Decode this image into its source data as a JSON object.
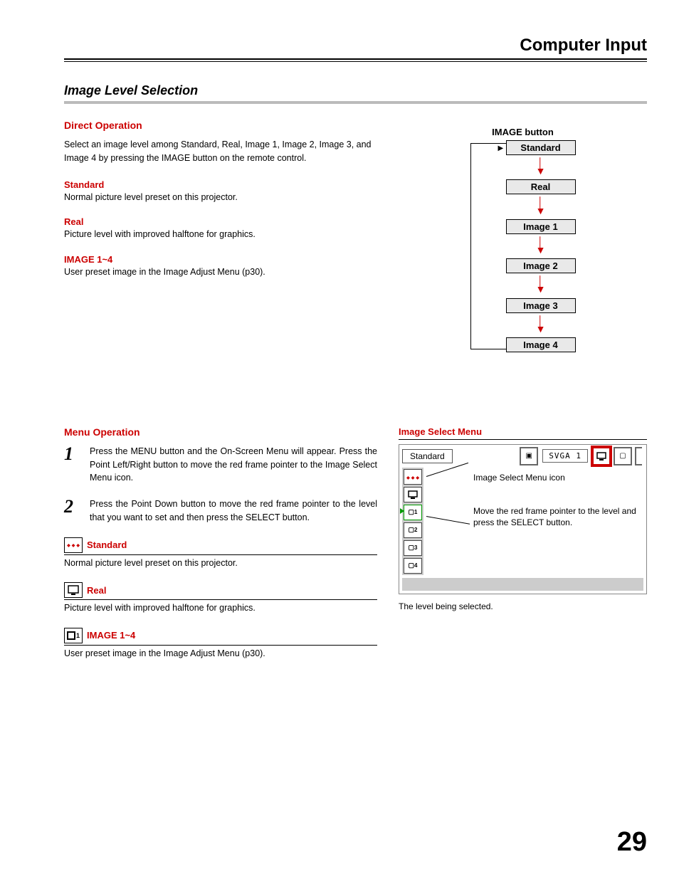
{
  "header": {
    "title": "Computer Input"
  },
  "section": {
    "title": "Image Level Selection"
  },
  "direct_operation": {
    "heading": "Direct Operation",
    "intro": "Select an image level among Standard, Real, Image 1, Image 2, Image 3, and Image 4 by pressing the IMAGE button on the remote control.",
    "items": [
      {
        "term": "Standard",
        "desc": "Normal picture level preset on this projector."
      },
      {
        "term": "Real",
        "desc": "Picture level with improved halftone for graphics."
      },
      {
        "term": "IMAGE 1~4",
        "desc": "User preset image in the Image Adjust Menu (p30)."
      }
    ]
  },
  "flow": {
    "title": "IMAGE button",
    "boxes": [
      "Standard",
      "Real",
      "Image 1",
      "Image 2",
      "Image 3",
      "Image 4"
    ]
  },
  "menu_operation": {
    "heading": "Menu Operation",
    "steps": [
      {
        "num": "1",
        "text": "Press the MENU button and the On-Screen Menu will appear. Press the Point Left/Right button to move the red frame pointer to the Image Select Menu icon."
      },
      {
        "num": "2",
        "text": "Press the Point Down button to move the red frame pointer to the level that you want to set and then press the SELECT button."
      }
    ],
    "icon_items": [
      {
        "label": "Standard",
        "desc": "Normal picture level preset on this projector."
      },
      {
        "label": "Real",
        "desc": "Picture level with improved halftone for graphics."
      },
      {
        "label": "IMAGE 1~4",
        "desc": "User preset image in the Image Adjust Menu (p30)."
      }
    ]
  },
  "menu_preview": {
    "heading": "Image Select Menu",
    "top_label": "Standard",
    "svga_label": "SVGA 1",
    "side_icons": [
      "◆◆◆",
      "▢",
      "▢1",
      "▢2",
      "▢3",
      "▢4"
    ],
    "anno1": "Image Select Menu icon",
    "anno2": "Move the red frame pointer to the level and press the SELECT button.",
    "caption": "The level being selected."
  },
  "page_number": "29"
}
